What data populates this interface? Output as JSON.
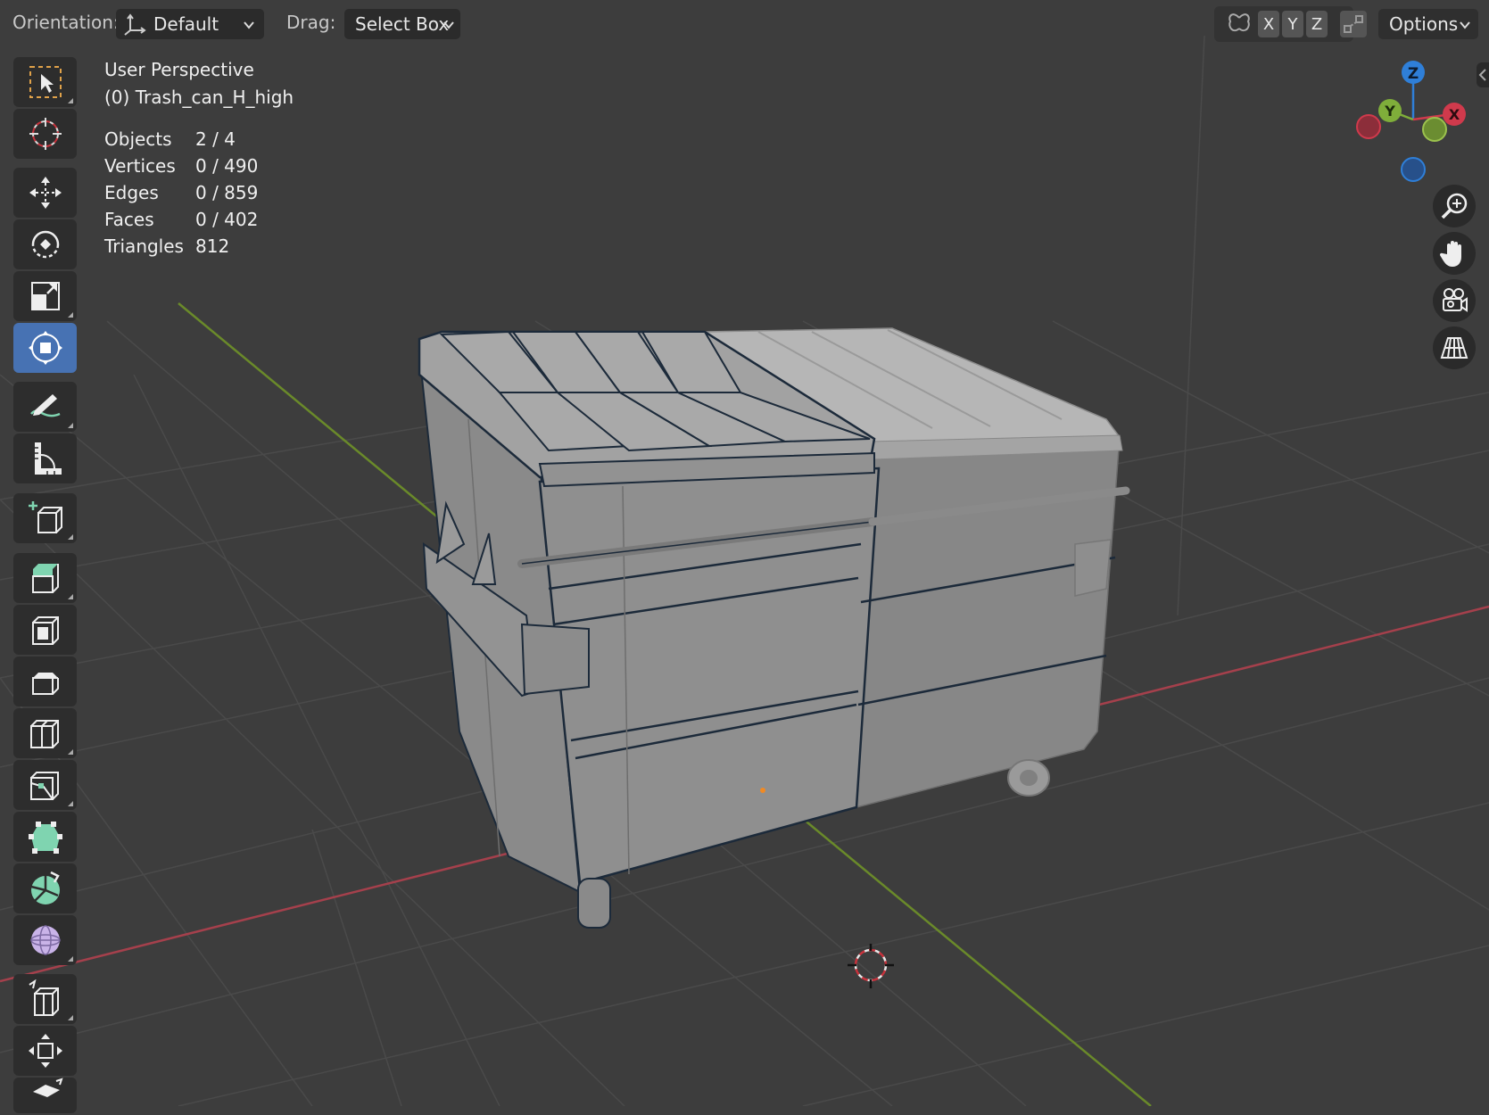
{
  "header": {
    "orientation_label": "Orientation:",
    "orientation_value": "Default",
    "drag_label": "Drag:",
    "drag_value": "Select Box",
    "axis_x": "X",
    "axis_y": "Y",
    "axis_z": "Z",
    "options_label": "Options"
  },
  "overlay": {
    "view_name": "User Perspective",
    "object_name": "(0) Trash_can_H_high",
    "stats": [
      {
        "label": "Objects",
        "value": "2 / 4"
      },
      {
        "label": "Vertices",
        "value": "0 / 490"
      },
      {
        "label": "Edges",
        "value": "0 / 859"
      },
      {
        "label": "Faces",
        "value": "0 / 402"
      },
      {
        "label": "Triangles",
        "value": "812"
      }
    ]
  },
  "gizmo": {
    "z_label": "Z",
    "y_label": "Y",
    "x_label": "X",
    "colors": {
      "x": "#d03a4c",
      "y": "#7fae3a",
      "z": "#2f7fd8"
    }
  },
  "toolbar": {
    "tools": [
      "select-box",
      "cursor",
      "move",
      "rotate",
      "scale",
      "transform",
      "annotate",
      "measure",
      "add-cube",
      "extrude-region",
      "inset-faces",
      "bevel",
      "loop-cut",
      "knife",
      "poly-build",
      "spin",
      "smooth",
      "edge-slide",
      "shrink-fatten",
      "shear"
    ],
    "active_tool": "transform"
  },
  "colors": {
    "background": "#3d3d3d",
    "grid": "#4a4a4a",
    "x_axis": "#b0414e",
    "y_axis": "#6e8f2a",
    "selected_outline": "#1c2a3a",
    "accent": "#4772b3"
  }
}
